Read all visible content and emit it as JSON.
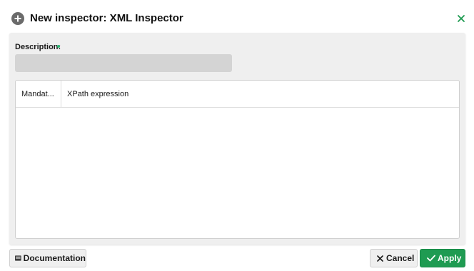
{
  "dialog": {
    "title": "New inspector: XML Inspector",
    "header_icon": "plus-circle-icon",
    "close_icon": "close-icon"
  },
  "form": {
    "description_label": "Description:",
    "description_value": "",
    "required_indicator_color": "#2bb673"
  },
  "grid": {
    "columns": [
      "Mandat...",
      "XPath expression"
    ],
    "rows": []
  },
  "footer": {
    "documentation_label": "Documentation",
    "documentation_icon": "book-icon",
    "cancel_label": "Cancel",
    "cancel_icon": "x-icon",
    "apply_label": "Apply",
    "apply_icon": "check-icon"
  },
  "colors": {
    "accent": "#1f9b52",
    "close_icon": "#1f9b52"
  }
}
